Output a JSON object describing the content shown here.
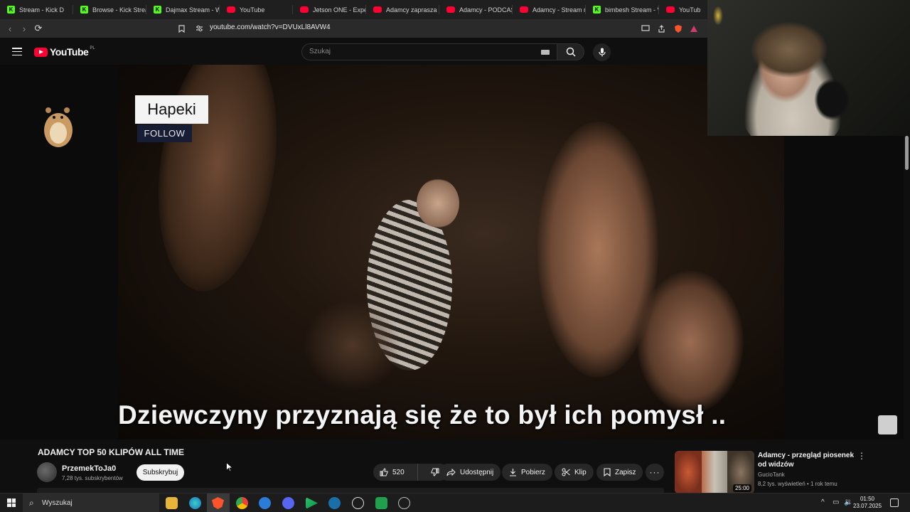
{
  "browser": {
    "tabs": [
      {
        "label": "Stream - Kick D",
        "icon": "kick-icon"
      },
      {
        "label": "Browse - Kick Strea",
        "icon": "kick-icon"
      },
      {
        "label": "Dajmax Stream - W",
        "icon": "kick-icon"
      },
      {
        "label": "YouTube",
        "icon": "youtube-icon"
      },
      {
        "label": "Jetson ONE - Expe",
        "icon": "youtube-icon"
      },
      {
        "label": "Adamcy zaprasza n",
        "icon": "youtube-icon"
      },
      {
        "label": "Adamcy - PODCAST",
        "icon": "youtube-icon"
      },
      {
        "label": "Adamcy - Stream n",
        "icon": "youtube-icon"
      },
      {
        "label": "bimbesh Stream - V",
        "icon": "kick-icon"
      },
      {
        "label": "YouTube",
        "icon": "youtube-icon"
      }
    ],
    "url": "youtube.com/watch?v=DVUxLl8AVW4"
  },
  "youtube": {
    "logo_text": "YouTube",
    "region": "PL",
    "search_placeholder": "Szukaj"
  },
  "video": {
    "overlay_name": "Hapeki",
    "overlay_follow": "FOLLOW",
    "subtitle": "Dziewczyny przyznają się że to był ich pomysł .."
  },
  "meta": {
    "title": "ADAMCY TOP 50 KLIPÓW ALL TIME",
    "channel": "PrzemekToJa0",
    "subscribers": "7,28 tys. subskrybentów",
    "subscribe_label": "Subskrybuj",
    "likes": "520",
    "share_label": "Udostępnij",
    "download_label": "Pobierz",
    "clip_label": "Klip",
    "save_label": "Zapisz"
  },
  "recommended": {
    "title": "Adamcy - przegląd piosenek od widzów",
    "channel": "GucioTank",
    "meta": "8,2 tys. wyświetleń • 1 rok temu",
    "duration": "25:00"
  },
  "taskbar": {
    "search_placeholder": "Wyszukaj",
    "time": "01:50",
    "date": "23.07.2025"
  },
  "colors": {
    "yt_red": "#ff0033",
    "kick_green": "#53fc18",
    "background": "#0f0f0f"
  }
}
